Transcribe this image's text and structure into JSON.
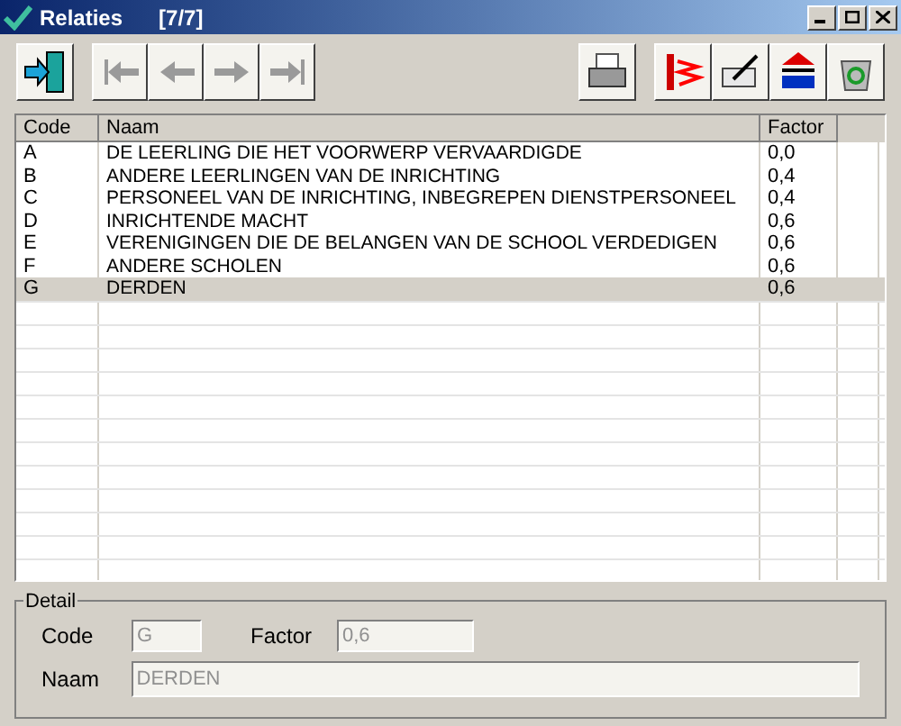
{
  "window": {
    "title": "Relaties",
    "counter": "[7/7]"
  },
  "nav_buttons": [
    {
      "kind": "first",
      "disabled": true
    },
    {
      "kind": "prev",
      "disabled": true
    },
    {
      "kind": "next",
      "disabled": true
    },
    {
      "kind": "last",
      "disabled": true
    }
  ],
  "table": {
    "columns": [
      "Code",
      "Naam",
      "Factor"
    ],
    "rows": [
      {
        "cells": [
          "A",
          "DE LEERLING DIE HET VOORWERP VERVAARDIGDE",
          "0,0"
        ],
        "selected": false
      },
      {
        "cells": [
          "B",
          "ANDERE LEERLINGEN VAN DE INRICHTING",
          "0,4"
        ],
        "selected": false
      },
      {
        "cells": [
          "C",
          "PERSONEEL VAN DE INRICHTING, INBEGREPEN DIENSTPERSONEEL",
          "0,4"
        ],
        "selected": false
      },
      {
        "cells": [
          "D",
          "INRICHTENDE MACHT",
          "0,6"
        ],
        "selected": false
      },
      {
        "cells": [
          "E",
          "VERENIGINGEN DIE DE BELANGEN VAN DE SCHOOL VERDEDIGEN",
          "0,6"
        ],
        "selected": false
      },
      {
        "cells": [
          "F",
          "ANDERE SCHOLEN",
          "0,6"
        ],
        "selected": false
      },
      {
        "cells": [
          "G",
          "DERDEN",
          "0,6"
        ],
        "selected": true
      }
    ]
  },
  "detail": {
    "title": "Detail",
    "code_label": "Code",
    "code_value": "G",
    "factor_label": "Factor",
    "factor_value": "0,6",
    "naam_label": "Naam",
    "naam_value": "DERDEN"
  }
}
